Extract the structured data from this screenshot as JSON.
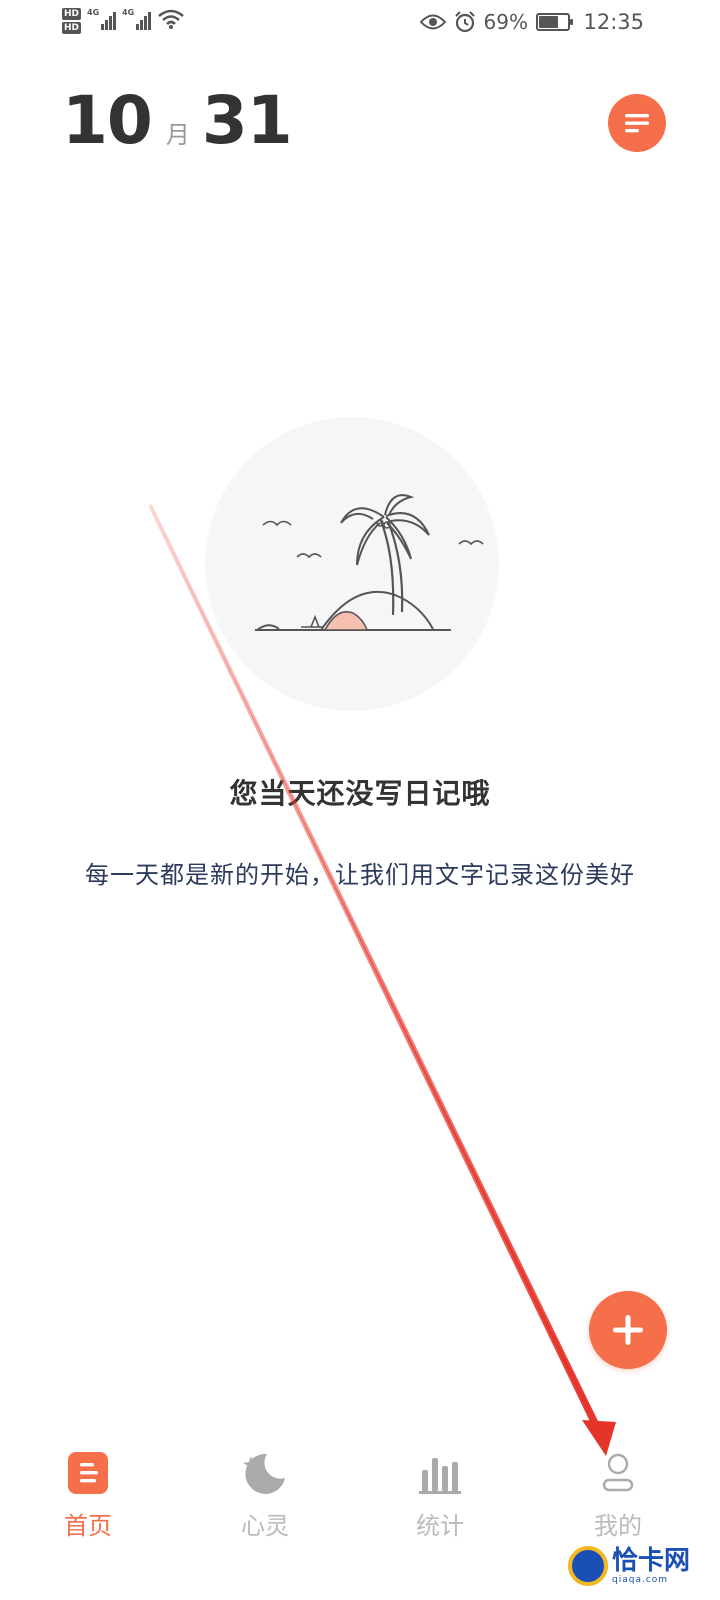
{
  "status_bar": {
    "hd1": "HD",
    "hd2": "HD",
    "net1": "4G",
    "net2": "4G",
    "battery_text": "69%",
    "battery_level": 0.69,
    "time": "12:35"
  },
  "header": {
    "month": "10",
    "month_unit": "月",
    "day": "31"
  },
  "empty_state": {
    "title": "您当天还没写日记哦",
    "subtitle": "每一天都是新的开始，让我们用文字记录这份美好"
  },
  "bottom_nav": {
    "items": [
      {
        "label": "首页",
        "icon": "document-icon",
        "active": true
      },
      {
        "label": "心灵",
        "icon": "moon-star-icon",
        "active": false
      },
      {
        "label": "统计",
        "icon": "bar-chart-icon",
        "active": false
      },
      {
        "label": "我的",
        "icon": "person-icon",
        "active": false
      }
    ]
  },
  "watermark": {
    "title": "恰卡网",
    "domain": "qiaqa.com"
  },
  "colors": {
    "accent": "#f56f4a",
    "arrow": "#e5342a",
    "inactive": "#bbbbbb"
  }
}
